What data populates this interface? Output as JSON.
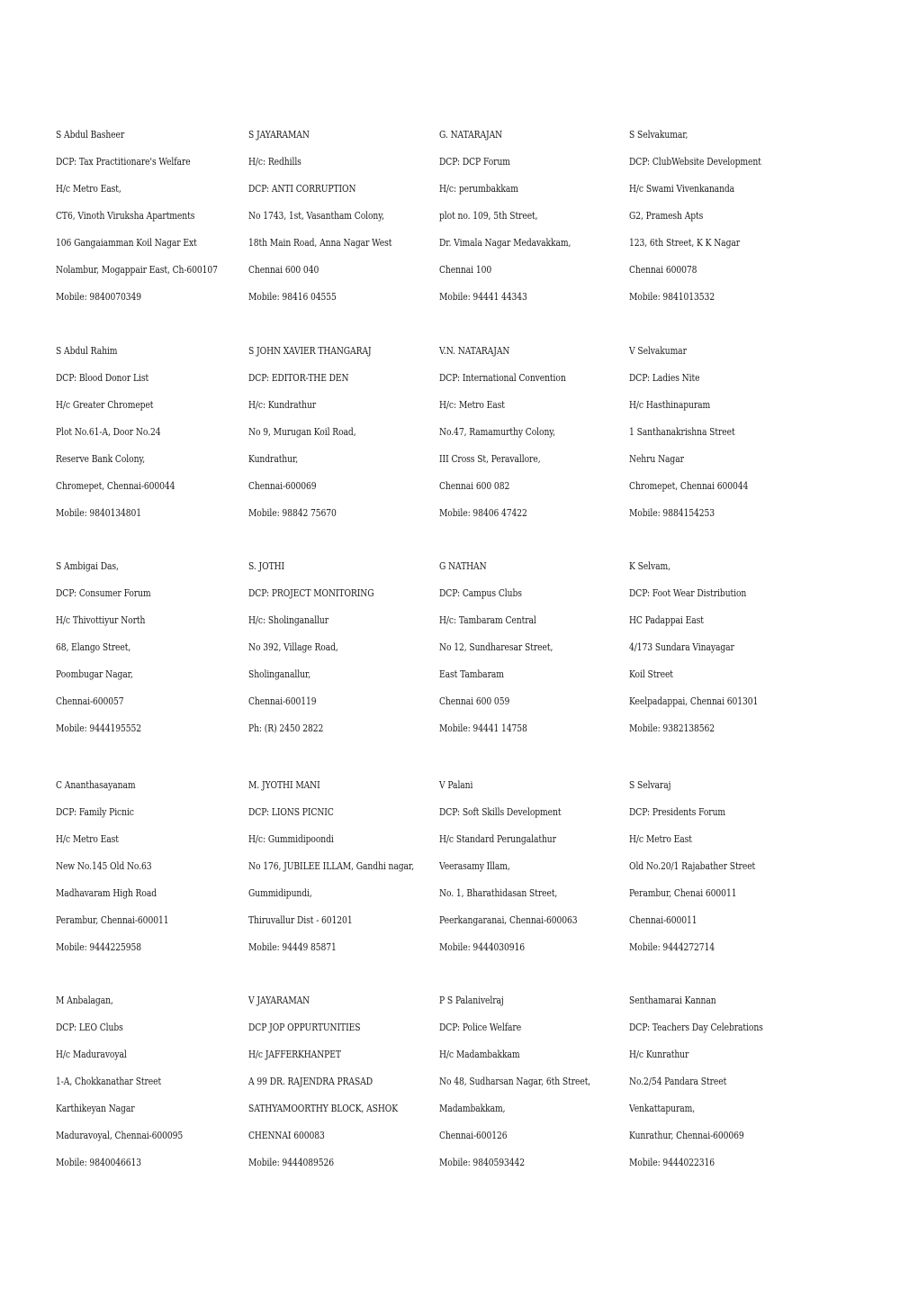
{
  "directory": {
    "rows": [
      [
        {
          "name": "S Abdul Basheer",
          "lines": [
            "DCP: Tax Practitionare's Welfare",
            "H/c Metro East,",
            "CT6, Vinoth Viruksha Apartments",
            "106 Gangaiamman Koil Nagar Ext",
            "Nolambur, Mogappair East, Ch-600107",
            "Mobile: 9840070349"
          ]
        },
        {
          "name": "S JAYARAMAN",
          "lines": [
            "H/c: Redhills",
            "DCP: ANTI CORRUPTION",
            "No 1743, 1st, Vasantham Colony,",
            "18th Main Road, Anna Nagar West",
            "Chennai 600 040",
            "Mobile: 98416 04555"
          ]
        },
        {
          "name": "G. NATARAJAN",
          "lines": [
            "DCP: DCP Forum",
            "H/c: perumbakkam",
            "plot no. 109, 5th Street,",
            "Dr. Vimala Nagar Medavakkam,",
            "Chennai 100",
            "Mobile: 94441 44343"
          ]
        },
        {
          "name": "S Selvakumar,",
          "lines": [
            "DCP: ClubWebsite Development",
            "H/c Swami Vivenkananda",
            "G2, Pramesh Apts",
            "123, 6th Street, K K Nagar",
            "Chennai 600078",
            "Mobile: 9841013532"
          ]
        }
      ],
      [
        {
          "name": "S Abdul Rahim",
          "lines": [
            "DCP: Blood Donor List",
            "H/c Greater Chromepet",
            "Plot No.61-A, Door No.24",
            "Reserve Bank Colony,",
            "Chromepet, Chennai-600044",
            "Mobile: 9840134801"
          ]
        },
        {
          "name": "S JOHN XAVIER THANGARAJ",
          "lines": [
            "DCP: EDITOR-THE DEN",
            "H/c: Kundrathur",
            "No 9, Murugan Koil Road,",
            "Kundrathur,",
            "Chennai-600069",
            "Mobile: 98842 75670"
          ]
        },
        {
          "name": "V.N. NATARAJAN",
          "lines": [
            "DCP: International Convention",
            "H/c: Metro East",
            "No.47, Ramamurthy Colony,",
            "III Cross St, Peravallore,",
            "Chennai 600 082",
            "Mobile: 98406 47422"
          ]
        },
        {
          "name": "V Selvakumar",
          "lines": [
            "DCP: Ladies Nite",
            "H/c Hasthinapuram",
            "1 Santhanakrishna Street",
            "Nehru Nagar",
            "Chromepet, Chennai 600044",
            "Mobile: 9884154253"
          ]
        }
      ],
      [
        {
          "name": "S Ambigai Das,",
          "lines": [
            "DCP: Consumer Forum",
            "H/c Thivottiyur North",
            "68, Elango Street,",
            "Poombugar Nagar,",
            "Chennai-600057",
            "Mobile: 9444195552"
          ]
        },
        {
          "name": "S. JOTHI",
          "lines": [
            "DCP: PROJECT MONITORING",
            "H/c: Sholinganallur",
            "No 392, Village Road,",
            "Sholinganallur,",
            "Chennai-600119",
            "Ph: (R) 2450 2822"
          ]
        },
        {
          "name": "G NATHAN",
          "lines": [
            "DCP: Campus Clubs",
            "H/c: Tambaram Central",
            "No 12, Sundharesar Street,",
            "East Tambaram",
            "Chennai 600 059",
            "Mobile: 94441 14758"
          ]
        },
        {
          "name": "K Selvam,",
          "lines": [
            "DCP: Foot Wear Distribution",
            "HC Padappai East",
            "4/173 Sundara Vinayagar",
            "Koil Street",
            "Keelpadappai, Chennai 601301",
            "Mobile: 9382138562"
          ]
        }
      ],
      [
        {
          "name": "C Ananthasayanam",
          "lines": [
            "DCP: Family Picnic",
            "H/c Metro East",
            "New No.145 Old No.63",
            "Madhavaram High Road",
            "Perambur, Chennai-600011",
            "Mobile: 9444225958"
          ]
        },
        {
          "name": "M. JYOTHI MANI",
          "lines": [
            "DCP: LIONS PICNIC",
            "H/c: Gummidipoondi",
            "No 176, JUBILEE ILLAM, Gandhi nagar,",
            "Gummidipundi,",
            "Thiruvallur Dist - 601201",
            "Mobile: 94449 85871"
          ]
        },
        {
          "name": "V Palani",
          "lines": [
            "DCP: Soft Skills Development",
            "H/c Standard Perungalathur",
            "Veerasamy Illam,",
            "No. 1, Bharathidasan Street,",
            "Peerkangaranai, Chennai-600063",
            "Mobile: 9444030916"
          ]
        },
        {
          "name": "S Selvaraj",
          "lines": [
            "DCP: Presidents Forum",
            "H/c Metro East",
            "Old No.20/1 Rajabather Street",
            "Perambur, Chenai 600011",
            "Chennai-600011",
            "Mobile: 9444272714"
          ]
        }
      ],
      [
        {
          "name": "M Anbalagan,",
          "lines": [
            "DCP: LEO Clubs",
            "H/c Maduravoyal",
            "1-A, Chokkanathar Street",
            "Karthikeyan Nagar",
            "Maduravoyal, Chennai-600095",
            "Mobile: 9840046613"
          ]
        },
        {
          "name": "V JAYARAMAN",
          "lines": [
            "DCP JOP OPPURTUNITIES",
            "H/c JAFFERKHANPET",
            "A 99 DR. RAJENDRA PRASAD",
            "SATHYAMOORTHY BLOCK, ASHOK",
            "CHENNAI 600083",
            "Mobile: 9444089526"
          ]
        },
        {
          "name": "P S Palanivelraj",
          "lines": [
            "DCP: Police Welfare",
            "H/c Madambakkam",
            "No 48, Sudharsan Nagar, 6th Street,",
            "Madambakkam,",
            "Chennai-600126",
            "Mobile: 9840593442"
          ]
        },
        {
          "name": "Senthamarai Kannan",
          "lines": [
            "DCP: Teachers Day Celebrations",
            "H/c Kunrathur",
            "No.2/54 Pandara Street",
            "Venkattapuram,",
            "Kunrathur, Chennai-600069",
            "Mobile: 9444022316"
          ]
        }
      ]
    ]
  }
}
